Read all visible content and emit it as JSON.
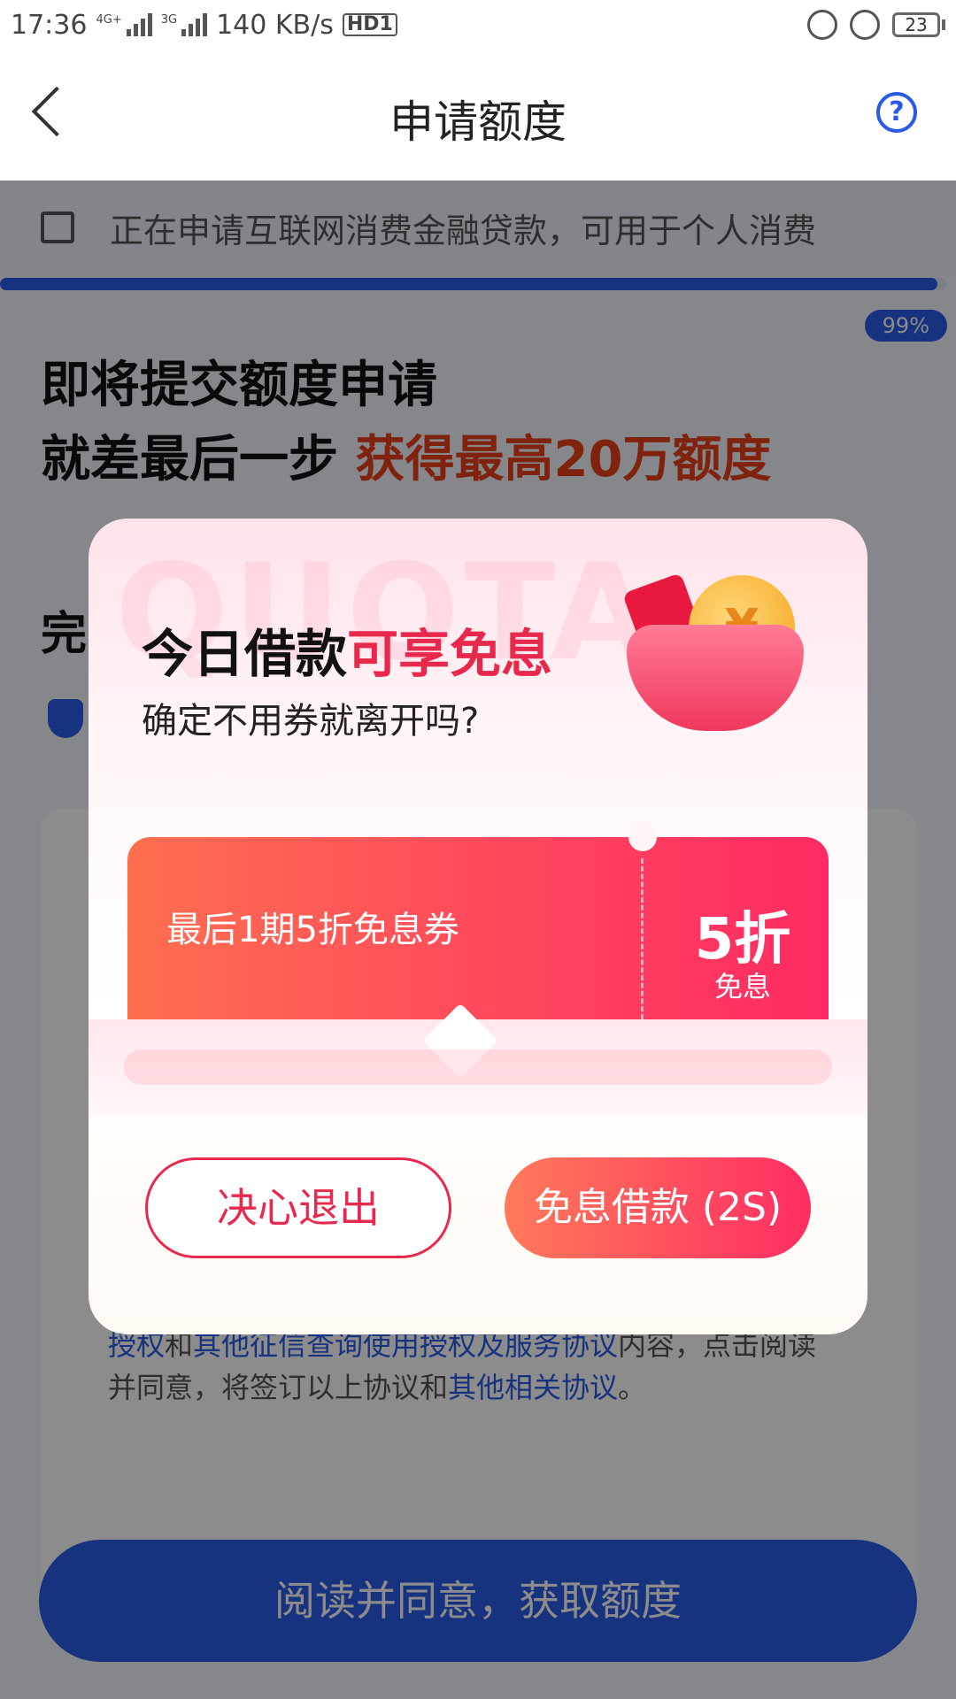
{
  "status_bar": {
    "time": "17:36",
    "network_1": "4G+",
    "network_2": "3G",
    "speed": "140 KB/s",
    "hd": "HD1",
    "battery": "23"
  },
  "header": {
    "title": "申请额度",
    "help_symbol": "?"
  },
  "background": {
    "notice": "正在申请互联网消费金融贷款，可用于个人消费",
    "progress_percent": 99,
    "progress_label": "99%",
    "headline_line1": "即将提交额度申请",
    "headline_line2_prefix": "就差最后一步 ",
    "headline_line2_accent": "获得最高20万额度",
    "section_title": "完",
    "agreement_link1": "授权",
    "agreement_text1": "和",
    "agreement_link2": "其他征信查询使用授权及服务协议",
    "agreement_text2": "内容，点击阅读并同意，将签订以上协议和",
    "agreement_link3": "其他相关协议",
    "agreement_text3": "。",
    "primary_button": "阅读并同意，获取额度"
  },
  "modal": {
    "watermark": "QUOTA",
    "title_prefix": "今日借款",
    "title_accent": "可享免息",
    "subtitle": "确定不用券就离开吗?",
    "coin_symbol": "¥",
    "coupon": {
      "name": "最后1期5折免息券",
      "value": "5折",
      "tag": "免息"
    },
    "exit_button": "决心退出",
    "borrow_button": "免息借款 (2S)"
  },
  "colors": {
    "brand_blue": "#2b5be6",
    "accent_red": "#e8294e",
    "headline_accent": "#e8401c"
  }
}
